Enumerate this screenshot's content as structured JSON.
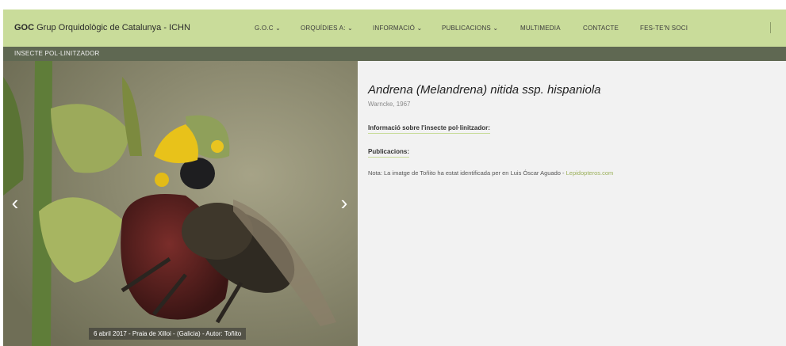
{
  "header": {
    "brand_short": "GOC",
    "brand_name": "Grup Orquidològic de Catalunya - ICHN",
    "nav": [
      "G.O.C ⌄",
      "ORQUÍDIES A: ⌄",
      "INFORMACIÓ ⌄",
      "PUBLICACIONS ⌄",
      "MULTIMEDIA",
      "CONTACTE",
      "FES-TE'N SOCI"
    ]
  },
  "breadcrumb": "INSECTE POL·LINITZADOR",
  "photo": {
    "caption": "6 abril 2017 - Praia de Xilloi - (Galicia) - Autor: Toñito",
    "prev_icon": "chevron-left-icon",
    "next_icon": "chevron-right-icon"
  },
  "detail": {
    "title": "Andrena (Melandrena) nitida ssp. hispaniola",
    "author": "Warncke, 1967",
    "section_info": "Informació sobre l'insecte pol·linitzador:",
    "section_pubs": "Publicacions:",
    "note_text": "Nota: La imatge de Toñito ha estat identificada per en Luis Óscar Aguado -",
    "note_link": "Lepidopteros.com"
  },
  "colors": {
    "nav_bg": "#c9dc9a",
    "breadcrumb_bg": "#5f6852",
    "link": "#9bb05a"
  }
}
